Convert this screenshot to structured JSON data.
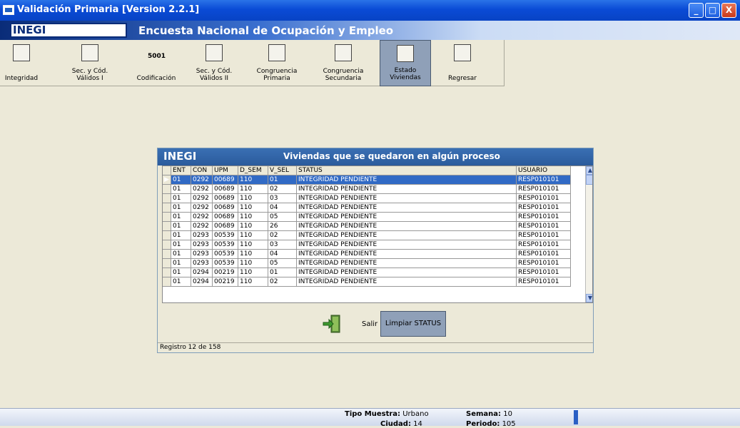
{
  "window": {
    "title": "Validación Primaria [Version 2.2.1]",
    "min": "_",
    "max": "□",
    "close": "X"
  },
  "banner": {
    "logo": "INEGI",
    "survey_title": "Encuesta Nacional de Ocupación y Empleo"
  },
  "toolbar": {
    "items": [
      {
        "label": "Integridad",
        "icon": "integrity-icon"
      },
      {
        "label": "Sec. y Cód.\nVálidos I",
        "icon": "grid-code-icon"
      },
      {
        "label": "Codificación",
        "icon": "code-5001-icon"
      },
      {
        "label": "Sec. y Cód.\nVálidos II",
        "icon": "grid-code-icon"
      },
      {
        "label": "Congruencia\nPrimaria",
        "icon": "congruence-icon"
      },
      {
        "label": "Congruencia\nSecundaria",
        "icon": "checklist-icon"
      },
      {
        "label": "Estado\nViviendas",
        "icon": "document-stack-icon"
      },
      {
        "label": "Regresar",
        "icon": "return-icon"
      }
    ],
    "icon_5001": "5001"
  },
  "panel": {
    "logo": "INEGI",
    "title": "Viviendas que se quedaron en algún proceso",
    "columns": [
      "ENT",
      "CON",
      "UPM",
      "D_SEM",
      "V_SEL",
      "STATUS",
      "USUARIO"
    ],
    "rows": [
      [
        "01",
        "0292",
        "00689",
        "110",
        "01",
        "INTEGRIDAD PENDIENTE",
        "RESP010101"
      ],
      [
        "01",
        "0292",
        "00689",
        "110",
        "02",
        "INTEGRIDAD PENDIENTE",
        "RESP010101"
      ],
      [
        "01",
        "0292",
        "00689",
        "110",
        "03",
        "INTEGRIDAD PENDIENTE",
        "RESP010101"
      ],
      [
        "01",
        "0292",
        "00689",
        "110",
        "04",
        "INTEGRIDAD PENDIENTE",
        "RESP010101"
      ],
      [
        "01",
        "0292",
        "00689",
        "110",
        "05",
        "INTEGRIDAD PENDIENTE",
        "RESP010101"
      ],
      [
        "01",
        "0292",
        "00689",
        "110",
        "26",
        "INTEGRIDAD PENDIENTE",
        "RESP010101"
      ],
      [
        "01",
        "0293",
        "00539",
        "110",
        "02",
        "INTEGRIDAD PENDIENTE",
        "RESP010101"
      ],
      [
        "01",
        "0293",
        "00539",
        "110",
        "03",
        "INTEGRIDAD PENDIENTE",
        "RESP010101"
      ],
      [
        "01",
        "0293",
        "00539",
        "110",
        "04",
        "INTEGRIDAD PENDIENTE",
        "RESP010101"
      ],
      [
        "01",
        "0293",
        "00539",
        "110",
        "05",
        "INTEGRIDAD PENDIENTE",
        "RESP010101"
      ],
      [
        "01",
        "0294",
        "00219",
        "110",
        "01",
        "INTEGRIDAD PENDIENTE",
        "RESP010101"
      ],
      [
        "01",
        "0294",
        "00219",
        "110",
        "02",
        "INTEGRIDAD PENDIENTE",
        "RESP010101"
      ]
    ],
    "selected_row": 0,
    "exit_label": "Salir",
    "clear_label": "Limpiar STATUS",
    "record_status": "Registro 12 de 158"
  },
  "statusbar": {
    "tipo_label": "Tipo Muestra:",
    "tipo_value": "Urbano",
    "semana_label": "Semana:",
    "semana_value": "10",
    "ciudad_label": "Ciudad:",
    "ciudad_value": "14",
    "periodo_label": "Periodo:",
    "periodo_value": "105"
  }
}
